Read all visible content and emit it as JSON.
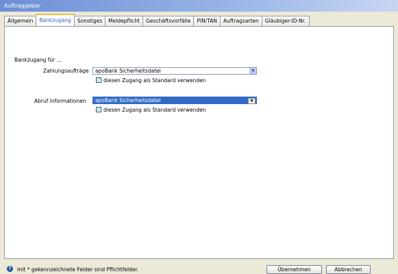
{
  "window": {
    "title": "Auftraggeber"
  },
  "tabs": [
    {
      "label": "Allgemein",
      "active": false
    },
    {
      "label": "Bankzugang",
      "active": true
    },
    {
      "label": "Sonstiges",
      "active": false
    },
    {
      "label": "Meldepflicht",
      "active": false
    },
    {
      "label": "Geschäftsvorfälle",
      "active": false
    },
    {
      "label": "PIN/TAN",
      "active": false
    },
    {
      "label": "Auftragsarten",
      "active": false
    },
    {
      "label": "Gläubiger-ID-Nr.",
      "active": false
    }
  ],
  "section": {
    "heading": "Bankzugang für ..."
  },
  "zahlung": {
    "label": "Zahlungsaufträge",
    "value": "apoBank Sicherheitsdatei",
    "checkbox_label": "diesen Zugang als Standard verwenden",
    "checked": true
  },
  "abruf": {
    "label": "Abruf Informationen",
    "value": "apoBank Sicherheitsdatei",
    "checkbox_label": "diesen Zugang als Standard verwenden",
    "checked": true
  },
  "footer": {
    "hint": "mit * gekennzeichnete Felder sind Pflichtfelder.",
    "apply_label": "Übernehmen",
    "cancel_label": "Abbrechen"
  },
  "icons": {
    "help": "help-icon",
    "dropdown": "chevron-down-icon",
    "check": "checkmark-icon"
  },
  "colors": {
    "titlebar": "#6c8fd6",
    "selection": "#316ac5",
    "active_tab_text": "#3b66b8"
  }
}
